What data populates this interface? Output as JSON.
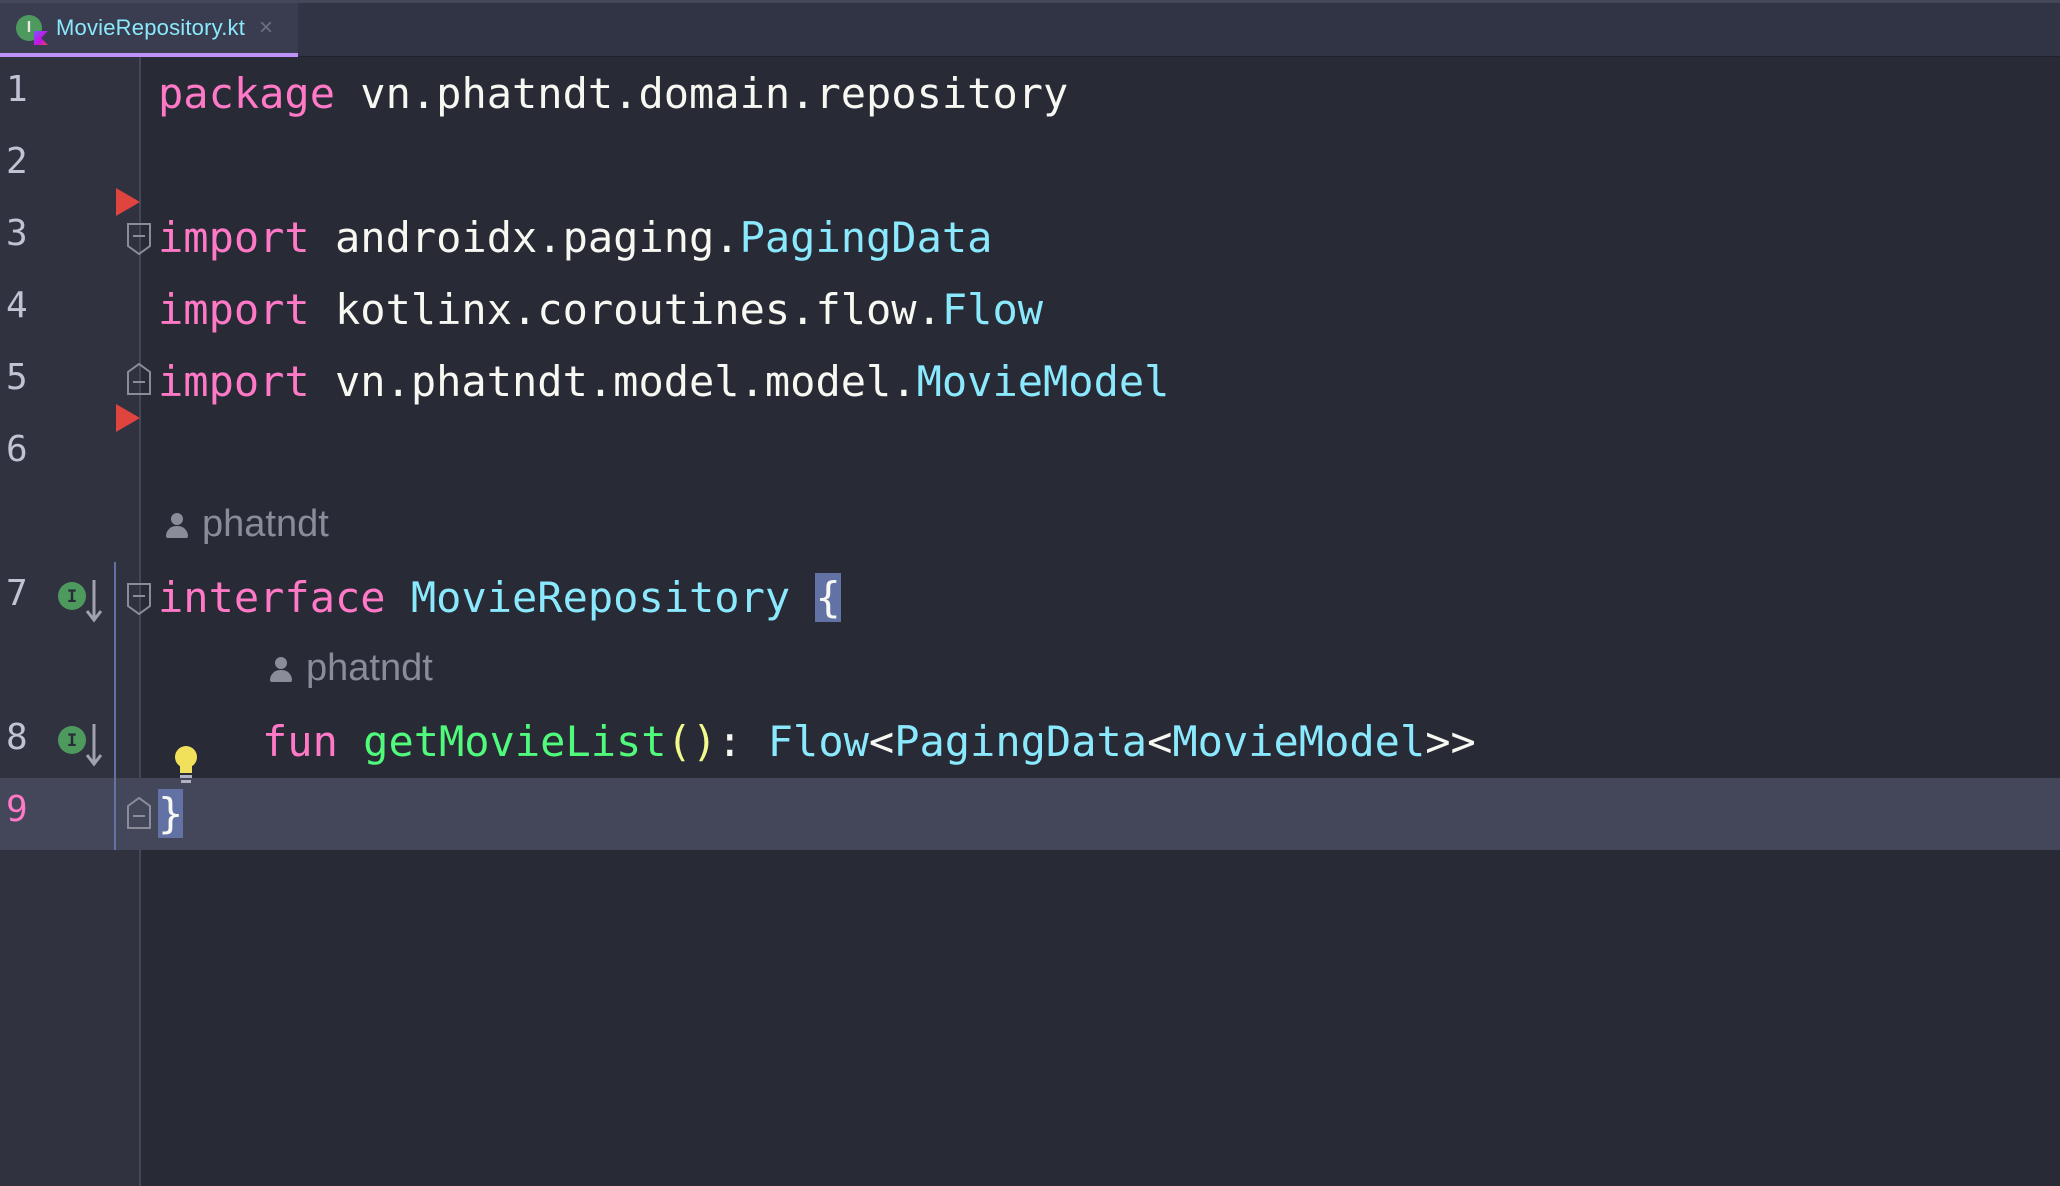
{
  "tab": {
    "label": "MovieRepository.kt",
    "close": "×",
    "icon": "kotlin-interface-file-icon"
  },
  "gutter": {
    "line_numbers": [
      "1",
      "2",
      "3",
      "4",
      "5",
      "6",
      "7",
      "8",
      "9"
    ],
    "active_line": "9"
  },
  "code": {
    "line1": {
      "kw": "package",
      "rest": " vn.phatndt.domain.repository"
    },
    "line3": {
      "kw": "import",
      "pkg": " androidx.paging.",
      "cls": "PagingData"
    },
    "line4": {
      "kw": "import",
      "pkg": " kotlinx.coroutines.flow.",
      "cls": "Flow"
    },
    "line5": {
      "kw": "import",
      "pkg": " vn.phatndt.model.model.",
      "cls": "MovieModel"
    },
    "author1": "phatndt",
    "line7": {
      "kw": "interface",
      "name": "MovieRepository",
      "brace": "{"
    },
    "author2": "phatndt",
    "line8": {
      "kw": "fun",
      "fn": "getMovieList",
      "parens": "()",
      "colon": ": ",
      "t1": "Flow",
      "lt1": "<",
      "t2": "PagingData",
      "lt2": "<",
      "t3": "MovieModel",
      "gt": ">>"
    },
    "line9": {
      "brace": "}"
    }
  },
  "colors": {
    "background": "#282a36",
    "keyword": "#ff79c6",
    "class": "#8be9fd",
    "function": "#50fa7b",
    "paren": "#f1fa8c",
    "text": "#f8f8f2",
    "bookmark": "#e0443e"
  }
}
